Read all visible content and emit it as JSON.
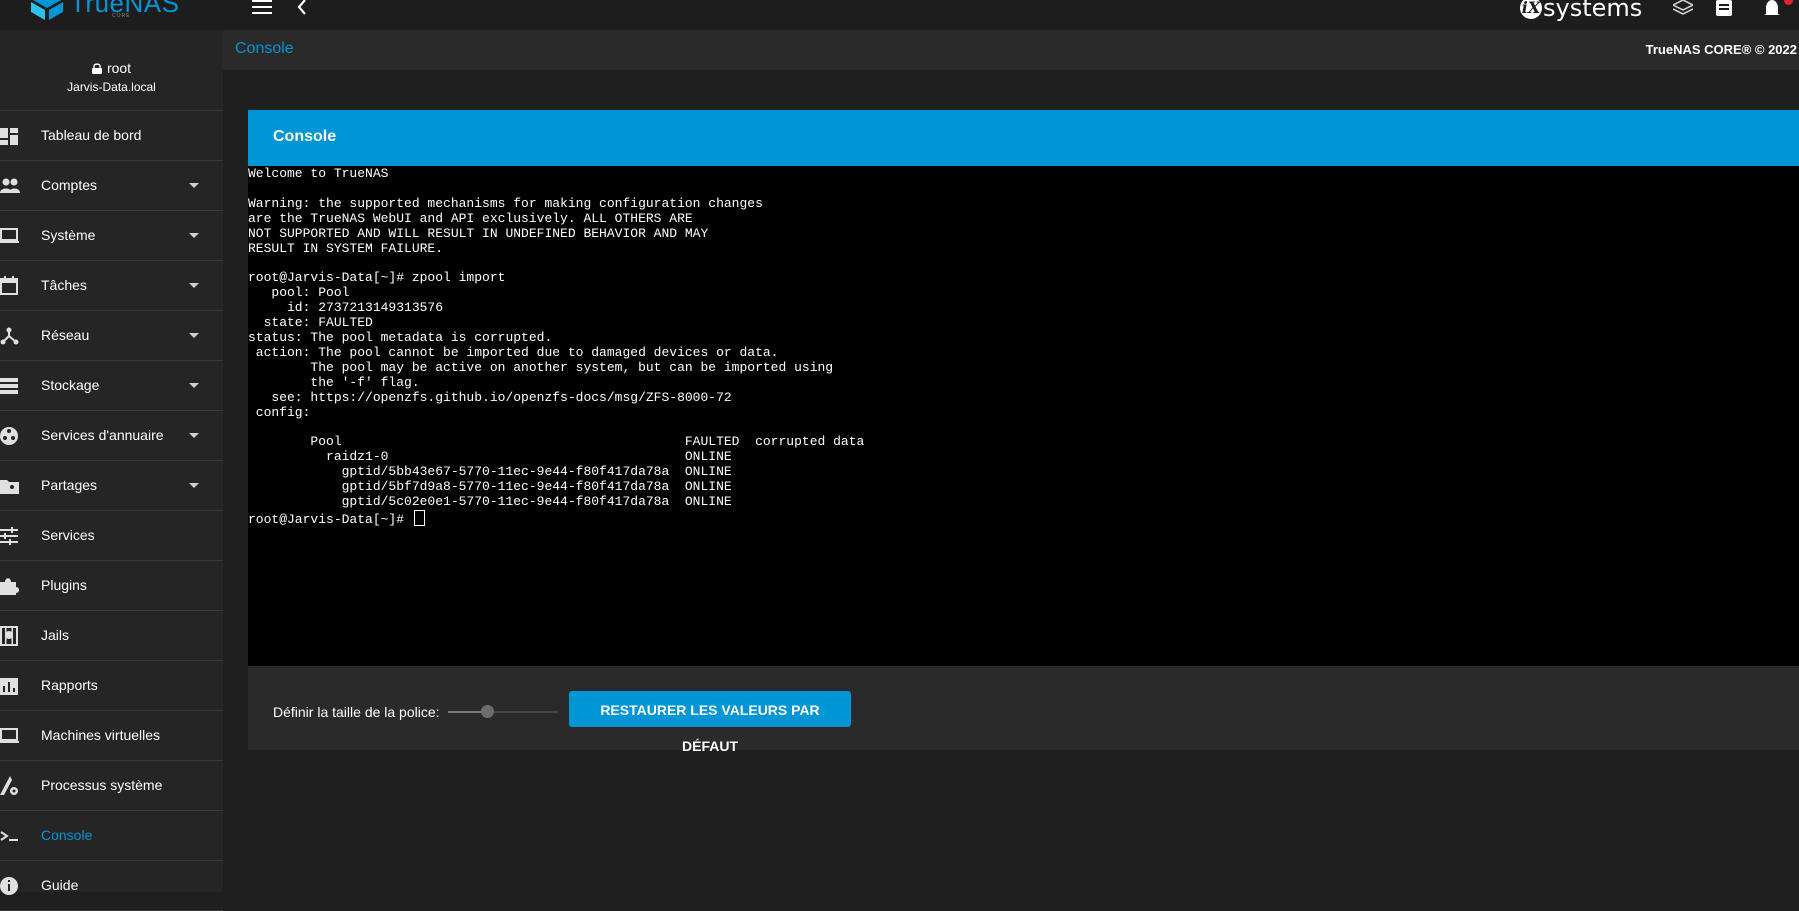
{
  "app": {
    "logo_text": "TrueNAS",
    "logo_sub": "CORE",
    "vendor_logo_mark": "iX",
    "vendor_logo_text": "systems"
  },
  "header": {
    "breadcrumb": "Console",
    "copyright": "TrueNAS CORE® © 2022"
  },
  "user": {
    "name": "root",
    "host": "Jarvis-Data.local"
  },
  "sidebar": {
    "items": [
      {
        "label": "Tableau de bord",
        "icon": "dashboard-icon",
        "expandable": false
      },
      {
        "label": "Comptes",
        "icon": "people-icon",
        "expandable": true
      },
      {
        "label": "Système",
        "icon": "laptop-icon",
        "expandable": true
      },
      {
        "label": "Tâches",
        "icon": "calendar-icon",
        "expandable": true
      },
      {
        "label": "Réseau",
        "icon": "network-icon",
        "expandable": true
      },
      {
        "label": "Stockage",
        "icon": "storage-icon",
        "expandable": true
      },
      {
        "label": "Services d'annuaire",
        "icon": "directory-icon",
        "expandable": true
      },
      {
        "label": "Partages",
        "icon": "folder-shared-icon",
        "expandable": true
      },
      {
        "label": "Services",
        "icon": "tune-icon",
        "expandable": false
      },
      {
        "label": "Plugins",
        "icon": "puzzle-icon",
        "expandable": false
      },
      {
        "label": "Jails",
        "icon": "jail-icon",
        "expandable": false
      },
      {
        "label": "Rapports",
        "icon": "chart-icon",
        "expandable": false
      },
      {
        "label": "Machines virtuelles",
        "icon": "computer-icon",
        "expandable": false
      },
      {
        "label": "Processus système",
        "icon": "process-icon",
        "expandable": false
      },
      {
        "label": "Console",
        "icon": "console-icon",
        "expandable": false,
        "active": true
      },
      {
        "label": "Guide",
        "icon": "info-icon",
        "expandable": false
      }
    ]
  },
  "console": {
    "title": "Console",
    "output": "Welcome to TrueNAS\n\nWarning: the supported mechanisms for making configuration changes\nare the TrueNAS WebUI and API exclusively. ALL OTHERS ARE\nNOT SUPPORTED AND WILL RESULT IN UNDEFINED BEHAVIOR AND MAY\nRESULT IN SYSTEM FAILURE.\n\nroot@Jarvis-Data[~]# zpool import\n   pool: Pool\n     id: 2737213149313576\n  state: FAULTED\nstatus: The pool metadata is corrupted.\n action: The pool cannot be imported due to damaged devices or data.\n        The pool may be active on another system, but can be imported using\n        the '-f' flag.\n   see: https://openzfs.github.io/openzfs-docs/msg/ZFS-8000-72\n config:\n\n        Pool                                            FAULTED  corrupted data\n          raidz1-0                                      ONLINE\n            gptid/5bb43e67-5770-11ec-9e44-f80f417da78a  ONLINE\n            gptid/5bf7d9a8-5770-11ec-9e44-f80f417da78a  ONLINE\n            gptid/5c02e0e1-5770-11ec-9e44-f80f417da78a  ONLINE\n",
    "prompt": "root@Jarvis-Data[~]# ",
    "font_size_label": "Définir la taille de la police:",
    "font_size_level": 0.35,
    "reset_label": "RESTAURER LES VALEURS PAR DÉFAUT"
  },
  "colors": {
    "accent": "#0095d5",
    "notification": "#e3232e"
  }
}
